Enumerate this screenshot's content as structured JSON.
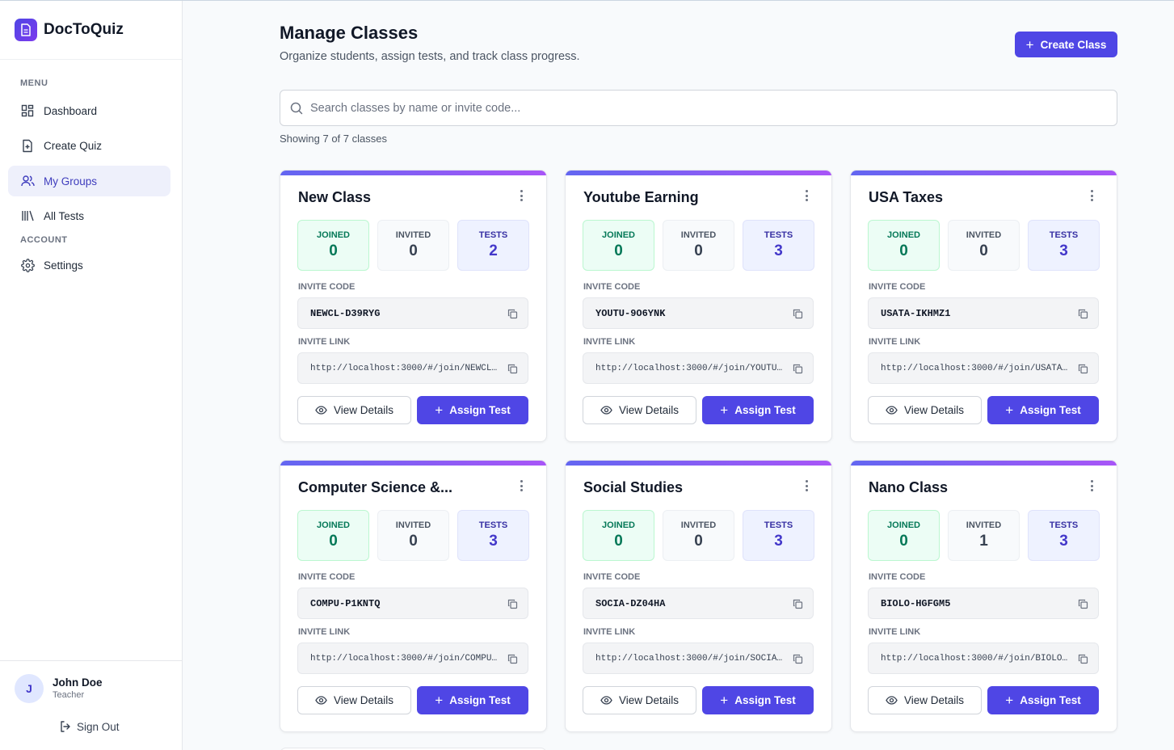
{
  "app": {
    "name": "DocToQuiz"
  },
  "sidebar": {
    "menu_label": "MENU",
    "account_label": "ACCOUNT",
    "items": [
      {
        "label": "Dashboard",
        "icon": "dashboard-icon"
      },
      {
        "label": "Create Quiz",
        "icon": "file-plus-icon"
      },
      {
        "label": "My Groups",
        "icon": "users-icon",
        "active": true
      },
      {
        "label": "All Tests",
        "icon": "library-icon"
      },
      {
        "label": "Settings",
        "icon": "gear-icon"
      }
    ],
    "user": {
      "initial": "J",
      "name": "John Doe",
      "role": "Teacher"
    },
    "sign_out": "Sign Out"
  },
  "header": {
    "title": "Manage Classes",
    "subtitle": "Organize students, assign tests, and track class progress.",
    "create_button": "Create Class"
  },
  "search": {
    "placeholder": "Search classes by name or invite code...",
    "value": ""
  },
  "showing": "Showing 7 of 7 classes",
  "labels": {
    "joined": "JOINED",
    "invited": "INVITED",
    "tests": "TESTS",
    "invite_code": "INVITE CODE",
    "invite_link": "INVITE LINK",
    "view_details": "View Details",
    "assign_test": "Assign Test"
  },
  "classes": [
    {
      "name": "New Class",
      "joined": "0",
      "invited": "0",
      "tests": "2",
      "code": "NEWCL-D39RYG",
      "link": "http://localhost:3000/#/join/NEWCL-D39…"
    },
    {
      "name": "Youtube Earning",
      "joined": "0",
      "invited": "0",
      "tests": "3",
      "code": "YOUTU-9O6YNK",
      "link": "http://localhost:3000/#/join/YOUTU-9O6…"
    },
    {
      "name": "USA Taxes",
      "joined": "0",
      "invited": "0",
      "tests": "3",
      "code": "USATA-IKHMZ1",
      "link": "http://localhost:3000/#/join/USATA-IKH…"
    },
    {
      "name": "Computer Science &...",
      "joined": "0",
      "invited": "0",
      "tests": "3",
      "code": "COMPU-P1KNTQ",
      "link": "http://localhost:3000/#/join/COMPU-P1K…"
    },
    {
      "name": "Social Studies",
      "joined": "0",
      "invited": "0",
      "tests": "3",
      "code": "SOCIA-DZ04HA",
      "link": "http://localhost:3000/#/join/SOCIA-DZ0…"
    },
    {
      "name": "Nano Class",
      "joined": "0",
      "invited": "1",
      "tests": "3",
      "code": "BIOLO-HGFGM5",
      "link": "http://localhost:3000/#/join/BIOLO-HGF…"
    }
  ],
  "colors": {
    "accent": "#4f46e5",
    "joined": "#047857",
    "tests": "#4338ca"
  }
}
